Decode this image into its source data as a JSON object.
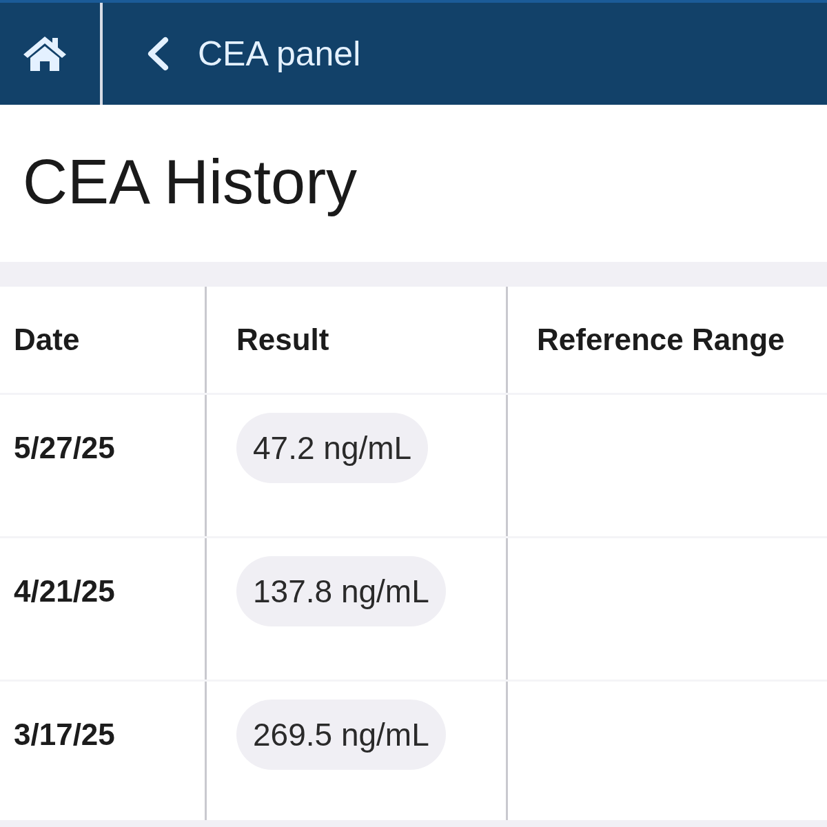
{
  "header": {
    "title": "CEA panel"
  },
  "page_title": "CEA History",
  "table": {
    "columns": [
      "Date",
      "Result",
      "Reference Range"
    ],
    "rows": [
      {
        "date": "5/27/25",
        "result": "47.2 ng/mL"
      },
      {
        "date": "4/21/25",
        "result": "137.8 ng/mL"
      },
      {
        "date": "3/17/25",
        "result": "269.5 ng/mL"
      }
    ]
  }
}
